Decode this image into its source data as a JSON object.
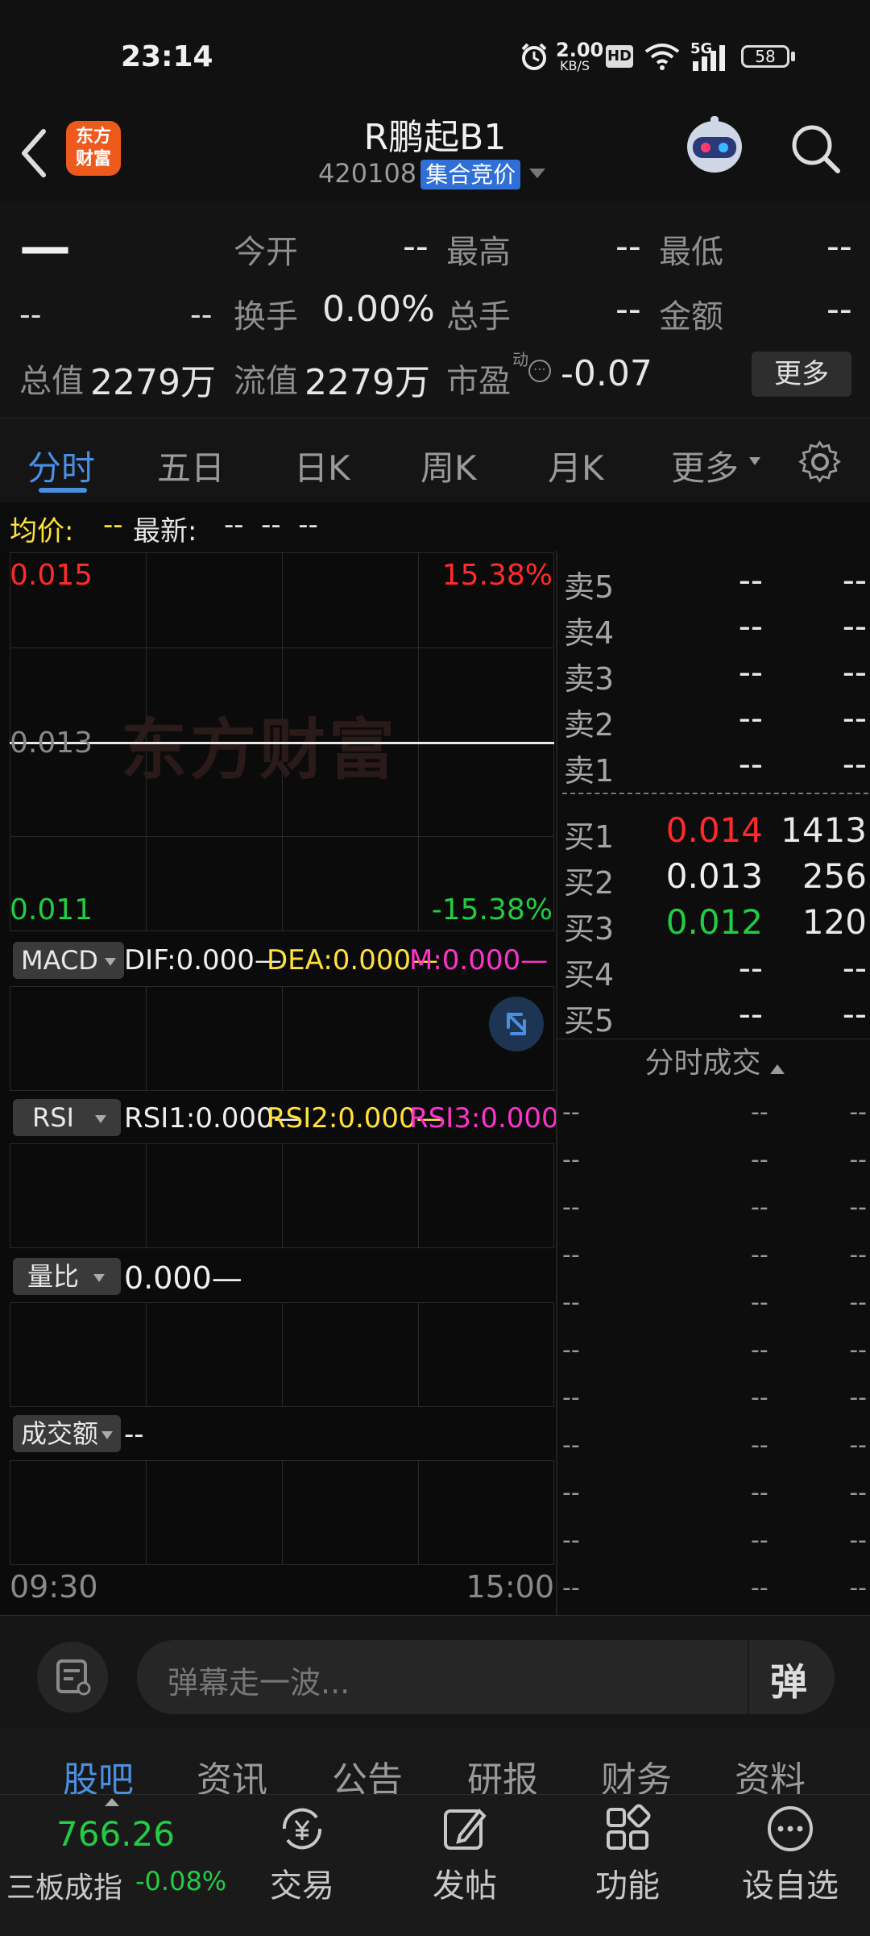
{
  "status_bar": {
    "time": "23:14",
    "net_speed": "2.00",
    "net_unit": "KB/S",
    "hd": "HD",
    "signal_label": "5G",
    "battery": "58"
  },
  "header": {
    "logo_line1": "东方",
    "logo_line2": "财富",
    "title": "R鹏起B1",
    "code": "420108",
    "badge": "集合竞价"
  },
  "quote": {
    "price": "—",
    "change": "--",
    "change_pct": "--",
    "rows": [
      [
        {
          "label": "今开",
          "value": "--"
        },
        {
          "label": "最高",
          "value": "--"
        },
        {
          "label": "最低",
          "value": "--"
        }
      ],
      [
        {
          "label": "换手",
          "value": "0.00%"
        },
        {
          "label": "总手",
          "value": "--"
        },
        {
          "label": "金额",
          "value": "--"
        }
      ]
    ],
    "total_value_label": "总值",
    "total_value": "2279万",
    "float_value_label": "流值",
    "float_value": "2279万",
    "pe_label": "市盈",
    "pe_sup": "动",
    "pe_value": "-0.07",
    "more_button": "更多"
  },
  "tabs": {
    "items": [
      "分时",
      "五日",
      "日K",
      "周K",
      "月K",
      "更多"
    ],
    "active": "分时"
  },
  "info_line": {
    "avg_label": "均价:",
    "avg_value": "--",
    "latest_label": "最新:",
    "latest_values": "--  --  --"
  },
  "chart": {
    "y_top": "0.015",
    "y_mid": "0.013",
    "y_bottom": "0.011",
    "pct_top": "15.38%",
    "pct_bottom": "-15.38%",
    "watermark": "东方财富",
    "time_start": "09:30",
    "time_end": "15:00",
    "macd": {
      "name": "MACD",
      "dif": "DIF:0.000",
      "dea": "DEA:0.000",
      "m": "M:0.000"
    },
    "rsi": {
      "name": "RSI",
      "rsi1": "RSI1:0.000",
      "rsi2": "RSI2:0.000",
      "rsi3": "RSI3:0.000"
    },
    "volume_ratio": {
      "name": "量比",
      "value": "0.000"
    },
    "turnover": {
      "name": "成交额",
      "value": "--"
    },
    "colors": {
      "up": "#ff2a2a",
      "down": "#22cc44",
      "yellow": "#ffe23b",
      "magenta": "#ff33cc"
    }
  },
  "order_book": {
    "sells": [
      {
        "name": "卖5",
        "price": "--",
        "volume": "--"
      },
      {
        "name": "卖4",
        "price": "--",
        "volume": "--"
      },
      {
        "name": "卖3",
        "price": "--",
        "volume": "--"
      },
      {
        "name": "卖2",
        "price": "--",
        "volume": "--"
      },
      {
        "name": "卖1",
        "price": "--",
        "volume": "--"
      }
    ],
    "buys": [
      {
        "name": "买1",
        "price": "0.014",
        "volume": "1413",
        "color": "#ff2a2a"
      },
      {
        "name": "买2",
        "price": "0.013",
        "volume": "256",
        "color": "#f0f0f0"
      },
      {
        "name": "买3",
        "price": "0.012",
        "volume": "120",
        "color": "#22cc44"
      },
      {
        "name": "买4",
        "price": "--",
        "volume": "--",
        "color": "#a5a5a5"
      },
      {
        "name": "买5",
        "price": "--",
        "volume": "--",
        "color": "#a5a5a5"
      }
    ],
    "trades_title": "分时成交",
    "trades": [
      "--",
      "--",
      "--",
      "--",
      "--",
      "--",
      "--",
      "--",
      "--",
      "--",
      "--"
    ]
  },
  "danmaku": {
    "placeholder": "弹幕走一波...",
    "send_label": "弹"
  },
  "bottom_tabs": {
    "items": [
      "股吧",
      "资讯",
      "公告",
      "研报",
      "财务",
      "资料"
    ],
    "active": "股吧"
  },
  "bottom_nav": {
    "index_value": "766.26",
    "index_name": "三板成指",
    "index_change": "-0.08%",
    "items": [
      "交易",
      "发帖",
      "功能",
      "设自选"
    ]
  }
}
